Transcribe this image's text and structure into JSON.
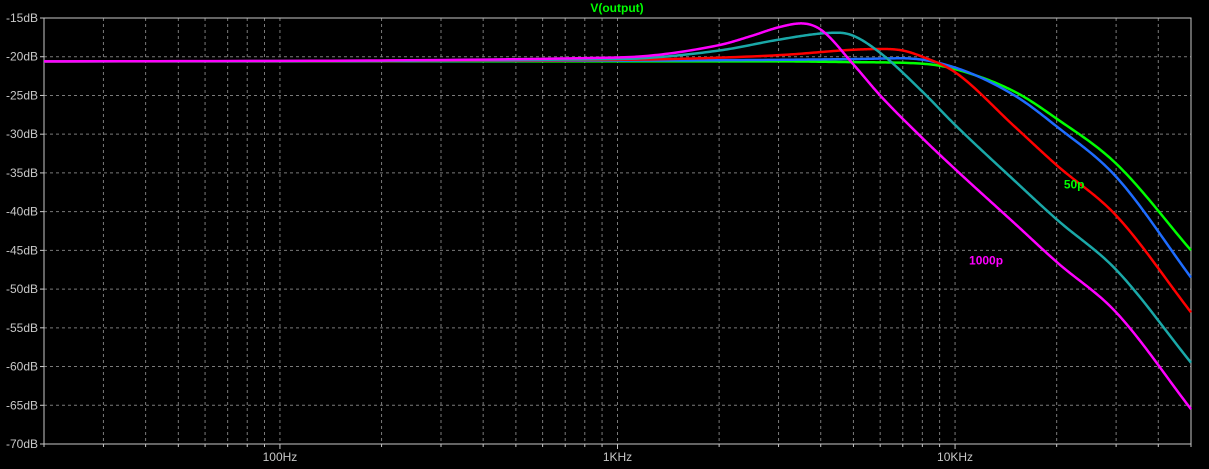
{
  "chart_data": {
    "type": "line",
    "title": "V(output)",
    "title_color": "#00ff00",
    "x_scale": "log",
    "xlim": [
      20,
      50000
    ],
    "ylim": [
      -70,
      -15
    ],
    "grid": true,
    "y_ticks": [
      -15,
      -20,
      -25,
      -30,
      -35,
      -40,
      -45,
      -50,
      -55,
      -60,
      -65,
      -70
    ],
    "y_tick_labels": [
      "-15dB",
      "-20dB",
      "-25dB",
      "-30dB",
      "-35dB",
      "-40dB",
      "-45dB",
      "-50dB",
      "-55dB",
      "-60dB",
      "-65dB",
      "-70dB"
    ],
    "x_ticks": [
      100,
      1000,
      10000
    ],
    "x_tick_labels": [
      "100Hz",
      "1KHz",
      "10KHz"
    ],
    "colors": {
      "background": "#000000",
      "axis": "#c8c8c8",
      "grid": "#7a7a7a"
    },
    "series": [
      {
        "color": "#00ff00",
        "x": [
          20,
          500,
          1000,
          3000,
          5000,
          8000,
          10000,
          15000,
          20000,
          30000,
          50000
        ],
        "y": [
          -20.6,
          -20.6,
          -20.6,
          -20.6,
          -20.7,
          -20.9,
          -21.6,
          -24.5,
          -28.0,
          -33.8,
          -45.0
        ]
      },
      {
        "color": "#1e6cff",
        "x": [
          20,
          1000,
          3000,
          5000,
          7000,
          10000,
          15000,
          20000,
          30000,
          50000
        ],
        "y": [
          -20.6,
          -20.5,
          -20.4,
          -20.3,
          -20.2,
          -21.4,
          -25.0,
          -29.0,
          -35.5,
          -48.5
        ]
      },
      {
        "color": "#ff0000",
        "x": [
          20,
          1000,
          3000,
          5000,
          6000,
          7000,
          8000,
          10000,
          15000,
          20000,
          30000,
          50000
        ],
        "y": [
          -20.6,
          -20.4,
          -19.8,
          -19.1,
          -19.0,
          -19.2,
          -20.0,
          -22.0,
          -29.0,
          -34.0,
          -40.5,
          -53.0
        ]
      },
      {
        "color": "#1aa8a8",
        "x": [
          20,
          1000,
          2000,
          3000,
          4000,
          4500,
          5000,
          6000,
          8000,
          10000,
          15000,
          20000,
          30000,
          50000
        ],
        "y": [
          -20.6,
          -20.3,
          -19.2,
          -17.8,
          -17.0,
          -16.9,
          -17.3,
          -19.5,
          -24.5,
          -28.8,
          -36.0,
          -41.0,
          -47.5,
          -59.5
        ]
      },
      {
        "color": "#ff00ff",
        "x": [
          20,
          1000,
          2000,
          2500,
          3000,
          3500,
          4000,
          5000,
          6000,
          8000,
          10000,
          15000,
          20000,
          30000,
          50000
        ],
        "y": [
          -20.6,
          -20.1,
          -18.5,
          -17.3,
          -16.2,
          -15.7,
          -16.5,
          -21.0,
          -25.0,
          -30.5,
          -34.5,
          -41.5,
          -46.5,
          -53.0,
          -65.5
        ]
      }
    ],
    "annotations": [
      {
        "text": "50p",
        "color": "#00ff00",
        "x": 21000,
        "y": -37
      },
      {
        "text": "1000p",
        "color": "#ff00ff",
        "x": 11000,
        "y": -46.8
      }
    ]
  }
}
